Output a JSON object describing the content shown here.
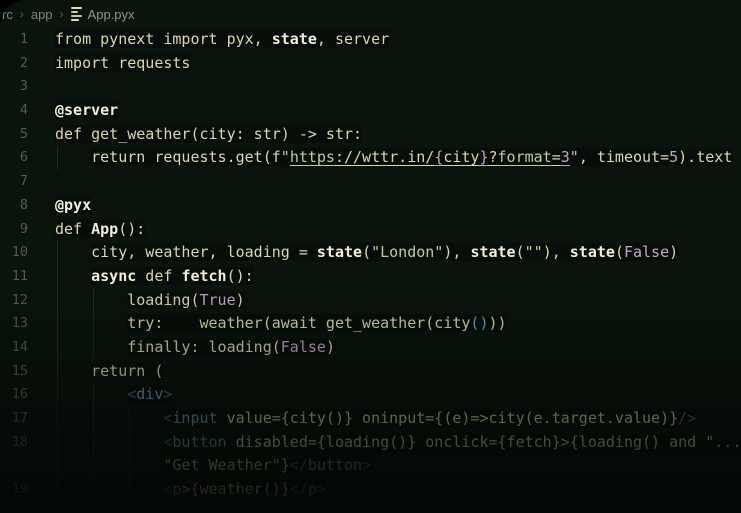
{
  "palette": {
    "bg": "#0a130c",
    "bar": "#040805",
    "crumb": "#79877b",
    "crumbFile": "#8d998f",
    "crumbSep": "#54625a",
    "gutter": "#4e5e51",
    "text": "#ddd6a6",
    "bright": "#f3eed7",
    "string": "#bccf96",
    "mauve": "#c9a2c6",
    "tag": "#66a0c0",
    "tagdim": "#41718a",
    "cyan": "#54a8cc",
    "guide": "#1d2b20",
    "iconA": "#e3dfae",
    "iconB": "#bfc7b4"
  },
  "breadcrumb": {
    "root": "rc",
    "folder": "app",
    "sep": "›",
    "file": "App.pyx",
    "file_icon": "list-lines-icon"
  },
  "code": {
    "lines": [
      {
        "n": "1",
        "i": 0,
        "g": 0,
        "t": [
          [
            "d",
            "from pynext import pyx, "
          ],
          [
            "b",
            "state"
          ],
          [
            "d",
            ", server"
          ]
        ]
      },
      {
        "n": "2",
        "i": 0,
        "g": 0,
        "t": [
          [
            "d",
            "import requests"
          ]
        ]
      },
      {
        "n": "3",
        "i": 0,
        "g": 0,
        "t": []
      },
      {
        "n": "4",
        "i": 0,
        "g": 0,
        "t": [
          [
            "b",
            "@server"
          ]
        ]
      },
      {
        "n": "5",
        "i": 0,
        "g": 0,
        "t": [
          [
            "d",
            "def get_weather(city: str) -> str:"
          ]
        ]
      },
      {
        "n": "6",
        "i": 4,
        "g": 1,
        "t": [
          [
            "d",
            "return requests.get(f"
          ],
          [
            "s",
            "\""
          ],
          [
            "su",
            "https"
          ],
          [
            "du",
            "://wttr.in/"
          ],
          [
            "pu",
            "{"
          ],
          [
            "du",
            "city"
          ],
          [
            "pu",
            "}"
          ],
          [
            "du",
            "?"
          ],
          [
            "su",
            "format"
          ],
          [
            "du",
            "="
          ],
          [
            "mu",
            "3"
          ],
          [
            "s",
            "\""
          ],
          [
            "d",
            ", timeout="
          ],
          [
            "m",
            "5"
          ],
          [
            "d",
            ").text"
          ]
        ]
      },
      {
        "n": "7",
        "i": 0,
        "g": 0,
        "t": []
      },
      {
        "n": "8",
        "i": 0,
        "g": 0,
        "t": [
          [
            "b",
            "@pyx"
          ]
        ]
      },
      {
        "n": "9",
        "i": 0,
        "g": 0,
        "t": [
          [
            "d",
            "def "
          ],
          [
            "b",
            "App"
          ],
          [
            "d",
            "():"
          ]
        ]
      },
      {
        "n": "10",
        "i": 4,
        "g": 1,
        "t": [
          [
            "d",
            "city, weather, loading = "
          ],
          [
            "b",
            "state"
          ],
          [
            "d",
            "("
          ],
          [
            "s",
            "\"London\""
          ],
          [
            "d",
            "), "
          ],
          [
            "b",
            "state"
          ],
          [
            "d",
            "("
          ],
          [
            "s",
            "\"\""
          ],
          [
            "d",
            "), "
          ],
          [
            "b",
            "state"
          ],
          [
            "d",
            "("
          ],
          [
            "m",
            "False"
          ],
          [
            "d",
            ")"
          ]
        ]
      },
      {
        "n": "11",
        "i": 4,
        "g": 1,
        "t": [
          [
            "b",
            "async"
          ],
          [
            "d",
            " def "
          ],
          [
            "b",
            "fetch"
          ],
          [
            "d",
            "():"
          ]
        ]
      },
      {
        "n": "12",
        "i": 8,
        "g": 2,
        "t": [
          [
            "d",
            "loading("
          ],
          [
            "m",
            "True"
          ],
          [
            "d",
            ")"
          ]
        ]
      },
      {
        "n": "13",
        "i": 8,
        "g": 2,
        "t": [
          [
            "d",
            "try:    weather(await get_weather(city"
          ],
          [
            "c",
            "()"
          ],
          [
            "d",
            "))"
          ]
        ]
      },
      {
        "n": "14",
        "i": 8,
        "g": 2,
        "t": [
          [
            "d",
            "finally: loading("
          ],
          [
            "m",
            "False"
          ],
          [
            "d",
            ")"
          ]
        ]
      },
      {
        "n": "15",
        "i": 4,
        "g": 1,
        "t": [
          [
            "d",
            "return ("
          ]
        ]
      },
      {
        "n": "16",
        "i": 8,
        "g": 2,
        "t": [
          [
            "k",
            "<"
          ],
          [
            "t",
            "div"
          ],
          [
            "k",
            ">"
          ]
        ]
      },
      {
        "n": "17",
        "i": 12,
        "g": 3,
        "t": [
          [
            "k",
            "<"
          ],
          [
            "t",
            "input"
          ],
          [
            "d",
            " value={city()} oninput={(e)=>city(e.target.value)}"
          ],
          [
            "k",
            "/>"
          ]
        ]
      },
      {
        "n": "18",
        "i": 12,
        "g": 3,
        "t": [
          [
            "k",
            "<"
          ],
          [
            "t",
            "button"
          ],
          [
            "d",
            " disabled={loading()} onclick={fetch}>{loading() and "
          ],
          [
            "s",
            "\"..."
          ]
        ]
      },
      {
        "n": "",
        "i": 12,
        "g": 3,
        "t": [
          [
            "s",
            "\"Get Weather\""
          ],
          [
            "d",
            "}"
          ],
          [
            "k",
            "</"
          ],
          [
            "t",
            "button"
          ],
          [
            "k",
            ">"
          ]
        ]
      },
      {
        "n": "19",
        "i": 12,
        "g": 3,
        "t": [
          [
            "k",
            "<"
          ],
          [
            "t",
            "p"
          ],
          [
            "d",
            ">{weather()}"
          ],
          [
            "k",
            "</"
          ],
          [
            "t",
            "p"
          ],
          [
            "k",
            ">"
          ]
        ]
      }
    ]
  }
}
